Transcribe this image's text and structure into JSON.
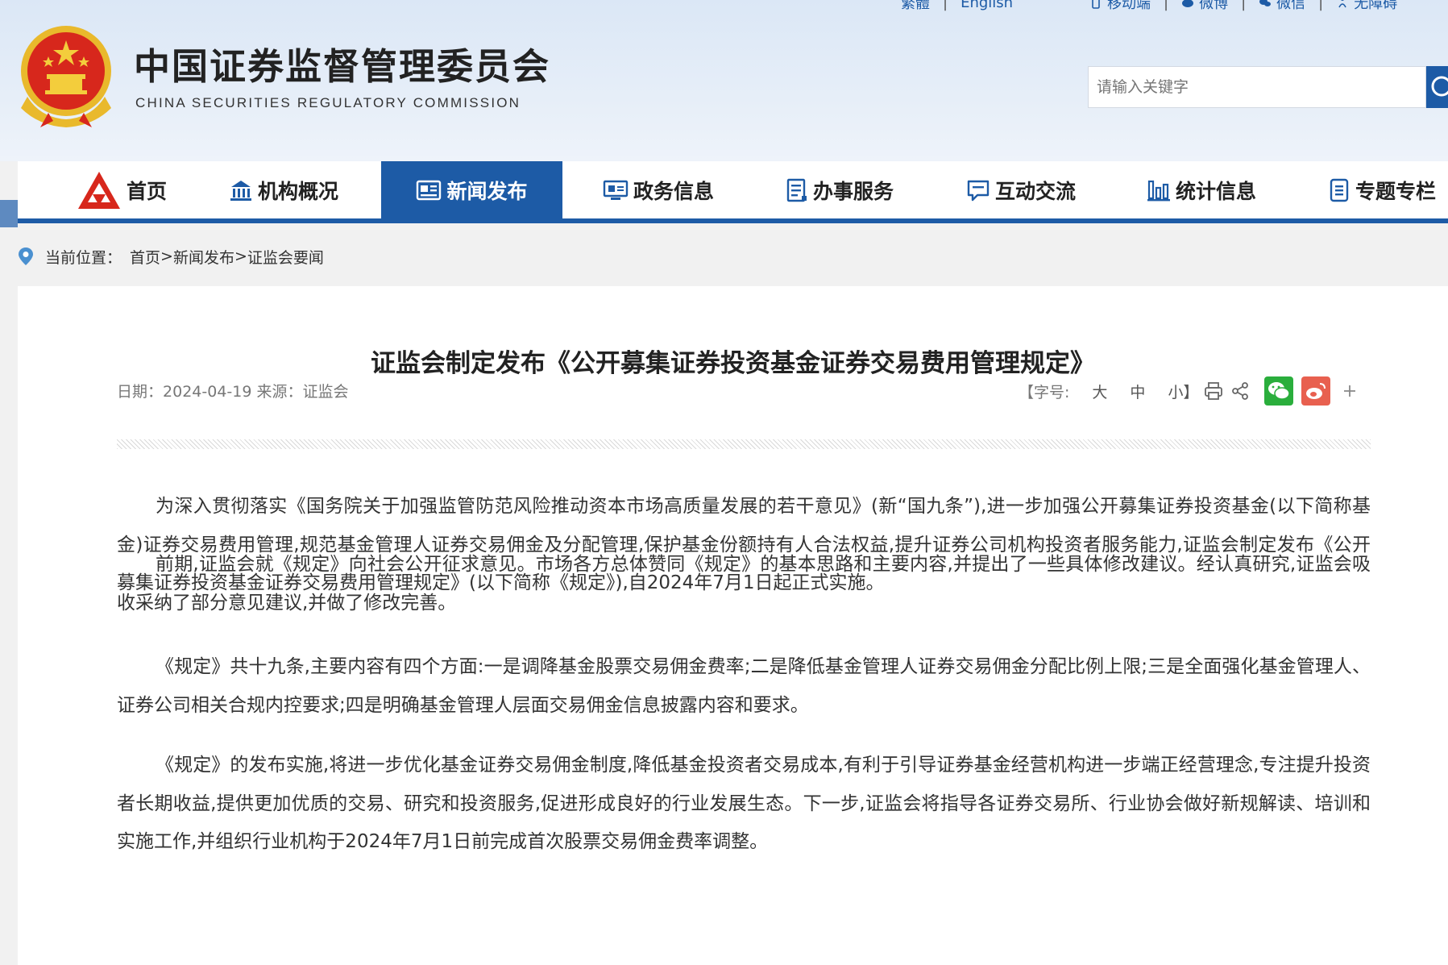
{
  "top_bar": {
    "traditional": "繁體",
    "english": "English",
    "mobile": "移动端",
    "weibo": "微博",
    "wechat": "微信",
    "accessibility": "无障碍"
  },
  "site": {
    "title_cn": "中国证券监督管理委员会",
    "title_en": "CHINA SECURITIES REGULATORY COMMISSION"
  },
  "search": {
    "placeholder": "请输入关键字"
  },
  "nav": {
    "items": [
      {
        "label": "首页",
        "icon": "csrc-logo-icon"
      },
      {
        "label": "机构概况",
        "icon": "building-icon"
      },
      {
        "label": "新闻发布",
        "icon": "news-icon",
        "active": true
      },
      {
        "label": "政务信息",
        "icon": "monitor-icon"
      },
      {
        "label": "办事服务",
        "icon": "form-icon"
      },
      {
        "label": "互动交流",
        "icon": "chat-icon"
      },
      {
        "label": "统计信息",
        "icon": "bar-chart-icon"
      },
      {
        "label": "专题专栏",
        "icon": "document-icon"
      }
    ],
    "active_color": "#1d5ba6"
  },
  "breadcrumb": {
    "label": "当前位置：",
    "items": [
      "首页",
      "新闻发布",
      "证监会要闻"
    ],
    "separator": ">"
  },
  "article": {
    "title": "证监会制定发布《公开募集证券投资基金证券交易费用管理规定》",
    "date_label": "日期：",
    "date": "2024-04-19",
    "source_label": "来源：",
    "source": "证监会",
    "font_size_label": "【字号:",
    "size_large": "大",
    "size_medium": "中",
    "size_small": "小】",
    "paragraphs": [
      "为深入贯彻落实《国务院关于加强监管防范风险推动资本市场高质量发展的若干意见》(新“国九条”),进一步加强公开募集证券投资基金(以下简称基金)证券交易费用管理,规范基金管理人证券交易佣金及分配管理,保护基金份额持有人合法权益,提升证券公司机构投资者服务能力,证监会制定发布《公开募集证券投资基金证券交易费用管理规定》(以下简称《规定》),自2024年7月1日起正式实施。",
      "前期,证监会就《规定》向社会公开征求意见。市场各方总体赞同《规定》的基本思路和主要内容,并提出了一些具体修改建议。经认真研究,证监会吸收采纳了部分意见建议,并做了修改完善。",
      "《规定》共十九条,主要内容有四个方面:一是调降基金股票交易佣金费率;二是降低基金管理人证券交易佣金分配比例上限;三是全面强化基金管理人、证券公司相关合规内控要求;四是明确基金管理人层面交易佣金信息披露内容和要求。",
      "《规定》的发布实施,将进一步优化基金证券交易佣金制度,降低基金投资者交易成本,有利于引导证券基金经营机构进一步端正经营理念,专注提升投资者长期收益,提供更加优质的交易、研究和投资服务,促进形成良好的行业发展生态。下一步,证监会将指导各证券交易所、行业协会做好新规解读、培训和实施工作,并组织行业机构于2024年7月1日前完成首次股票交易佣金费率调整。"
    ]
  },
  "colors": {
    "brand_blue": "#1d5ba6",
    "wechat_green": "#2aae3c",
    "weibo_red": "#e8604f"
  }
}
